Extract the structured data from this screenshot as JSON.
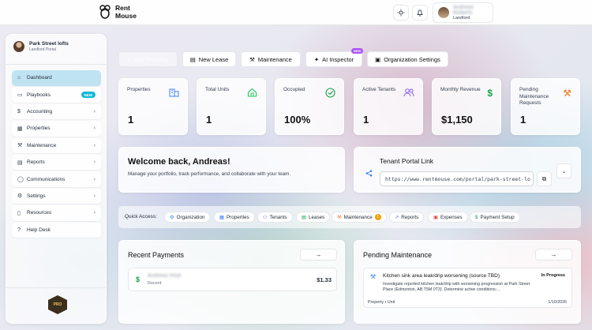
{
  "app": {
    "name_line1": "Rent",
    "name_line2": "Mouse"
  },
  "user": {
    "name": "Andreas Roberts",
    "role": "Landlord"
  },
  "sidebar": {
    "org_name": "Park Street lofts",
    "org_subtitle": "Landlord Portal",
    "items": [
      {
        "label": "Dashboard",
        "icon": "home-icon"
      },
      {
        "label": "Playbooks",
        "icon": "book-icon",
        "badge": "NEW"
      },
      {
        "label": "Accounting",
        "icon": "dollar-icon"
      },
      {
        "label": "Properties",
        "icon": "building-icon"
      },
      {
        "label": "Maintenance",
        "icon": "wrench-icon"
      },
      {
        "label": "Reports",
        "icon": "file-icon"
      },
      {
        "label": "Communications",
        "icon": "chat-icon"
      },
      {
        "label": "Settings",
        "icon": "gear-icon"
      },
      {
        "label": "Resources",
        "icon": "book-open-icon"
      },
      {
        "label": "Help Desk",
        "icon": "help-icon"
      }
    ],
    "pro_badge": "PRO"
  },
  "actions": {
    "add_property": "Add Property",
    "new_lease": "New Lease",
    "maintenance": "Maintenance",
    "ai_inspector": "AI Inspector",
    "ai_badge": "NEW",
    "org_settings": "Organization Settings"
  },
  "stats": [
    {
      "label": "Properties",
      "value": "1"
    },
    {
      "label": "Total Units",
      "value": "1"
    },
    {
      "label": "Occupied",
      "value": "100%"
    },
    {
      "label": "Active Tenants",
      "value": "1"
    },
    {
      "label": "Monthly Revenue",
      "value": "$1,150"
    },
    {
      "label": "Pending Maintenance Requests",
      "value": "1"
    }
  ],
  "welcome": {
    "title": "Welcome back, Andreas!",
    "subtitle": "Manage your portfolio, track performance, and collaborate with your team."
  },
  "tenant_portal": {
    "title": "Tenant Portal Link",
    "url": "https://www.rentmouse.com/portal/park-street-lo"
  },
  "quick_access": {
    "label": "Quick Access:",
    "items": [
      {
        "label": "Organization"
      },
      {
        "label": "Properties"
      },
      {
        "label": "Tenants"
      },
      {
        "label": "Leases"
      },
      {
        "label": "Maintenance",
        "badge": "1"
      },
      {
        "label": "Reports"
      },
      {
        "label": "Expenses"
      },
      {
        "label": "Payment Setup"
      }
    ]
  },
  "recent_payments": {
    "title": "Recent Payments",
    "rows": [
      {
        "name": "Andreas Hoyt",
        "sub": "Recent",
        "amount": "$1.33"
      }
    ]
  },
  "pending_maintenance": {
    "title": "Pending Maintenance",
    "rows": [
      {
        "title": "Kitchen sink area leak/drip worsening (source TBD)",
        "status": "In Progress",
        "description": "Investigate reported kitchen leak/drip with worsening progression at Park Street Place (Edmonton, AB T5M 0T3). Determine active conditions:...",
        "property": "Property • Unit",
        "date": "1/10/2026"
      }
    ]
  }
}
